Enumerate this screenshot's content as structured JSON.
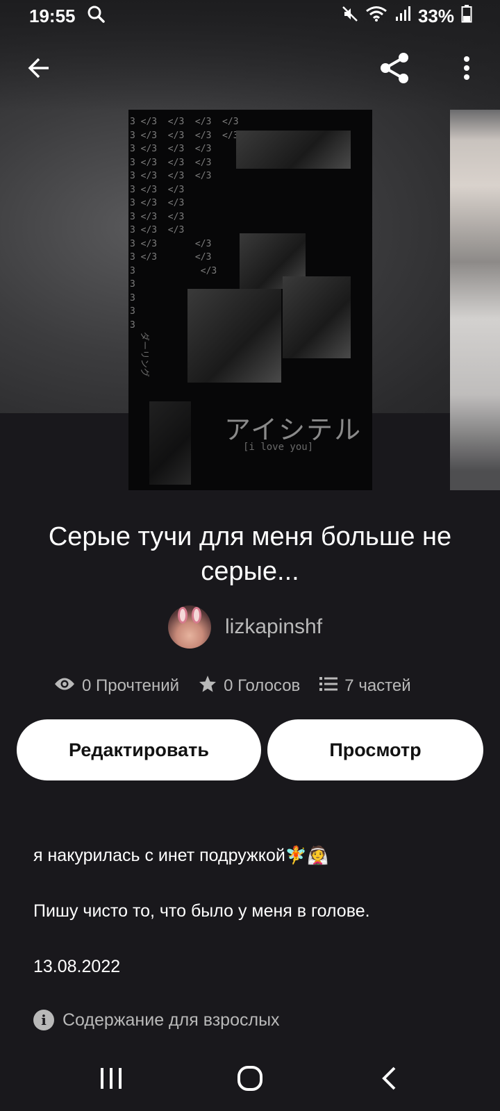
{
  "status_bar": {
    "time": "19:55",
    "battery": "33%",
    "icons": [
      "search-icon",
      "mute-icon",
      "wifi-icon",
      "signal-icon",
      "battery-icon"
    ]
  },
  "app_bar": {
    "icons": [
      "back-arrow-icon",
      "share-icon",
      "more-vert-icon"
    ]
  },
  "cover": {
    "code_glyph": "</3",
    "code_lines": [
      "3 </3  </3  </3  </3",
      "3 </3  </3  </3  </3",
      "3 </3  </3  </3",
      "3 </3  </3  </3",
      "3 </3  </3  </3",
      "3 </3  </3",
      "3 </3  </3",
      "3 </3  </3",
      "3 </3  </3",
      "3 </3       </3",
      "3 </3       </3",
      "3            </3",
      "3",
      "3",
      "3",
      "3"
    ],
    "japanese_text": "アイシテル",
    "english_text": "[i love you]",
    "vertical_text": "ダーリング"
  },
  "story": {
    "title": "Серые тучи для меня больше не серые...",
    "author": "lizkapinshf",
    "stats": {
      "reads": "0 Прочтений",
      "votes": "0 Голосов",
      "parts": "7 частей"
    },
    "buttons": {
      "edit": "Редактировать",
      "preview": "Просмотр"
    },
    "description": [
      "я накурилась с инет подружкой🧚👰",
      "Пишу чисто то, что было у меня в голове.",
      "13.08.2022"
    ],
    "mature_label": "Содержание для взрослых"
  },
  "nav_bar": {
    "icons": [
      "recents-icon",
      "home-icon",
      "nav-back-icon"
    ]
  }
}
